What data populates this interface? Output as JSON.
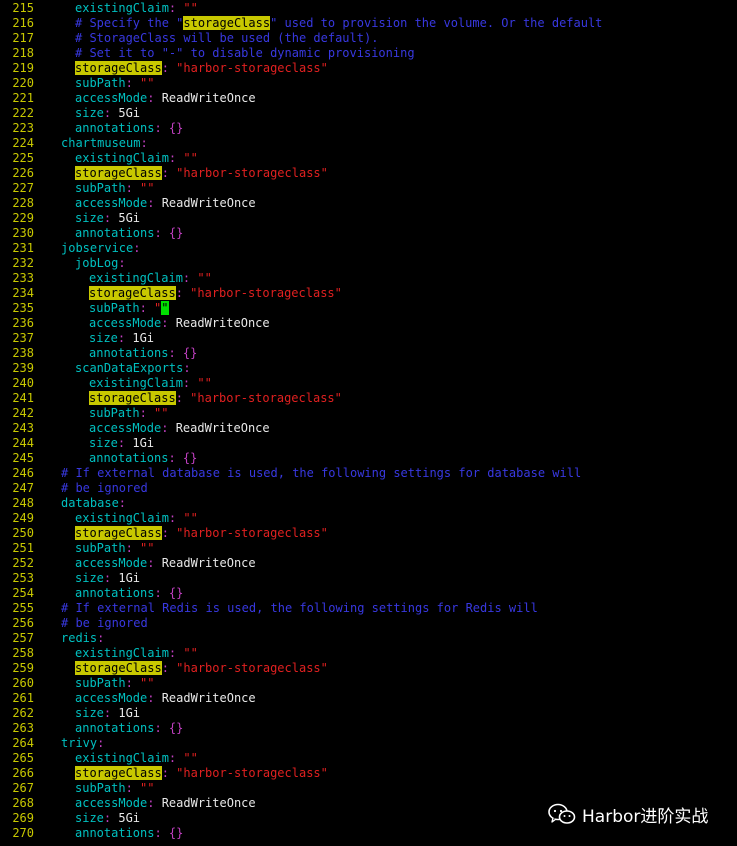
{
  "editor": {
    "colors": {
      "line_number": "#c8c800",
      "key": "#00c0c0",
      "punct": "#c040c0",
      "string": "#e02020",
      "value": "#e8e8e8",
      "comment": "#3838e0",
      "highlight": "#c8c800",
      "cursor": "#00e000"
    },
    "lines": [
      {
        "n": "215",
        "indent": 2,
        "segs": [
          [
            "k",
            "existingClaim"
          ],
          [
            "p",
            ": "
          ],
          [
            "s",
            "\"\""
          ]
        ]
      },
      {
        "n": "216",
        "indent": 2,
        "segs": [
          [
            "c",
            "# Specify the \""
          ],
          [
            "hl",
            "storageClass"
          ],
          [
            "c",
            "\" used to provision the volume. Or the default"
          ]
        ]
      },
      {
        "n": "217",
        "indent": 2,
        "segs": [
          [
            "c",
            "# StorageClass will be used (the default)."
          ]
        ]
      },
      {
        "n": "218",
        "indent": 2,
        "segs": [
          [
            "c",
            "# Set it to \"-\" to disable dynamic provisioning"
          ]
        ]
      },
      {
        "n": "219",
        "indent": 2,
        "segs": [
          [
            "hl",
            "storageClass"
          ],
          [
            "p",
            ": "
          ],
          [
            "s",
            "\"harbor-storageclass\""
          ]
        ]
      },
      {
        "n": "220",
        "indent": 2,
        "segs": [
          [
            "k",
            "subPath"
          ],
          [
            "p",
            ": "
          ],
          [
            "s",
            "\"\""
          ]
        ]
      },
      {
        "n": "221",
        "indent": 2,
        "segs": [
          [
            "k",
            "accessMode"
          ],
          [
            "p",
            ": "
          ],
          [
            "v",
            "ReadWriteOnce"
          ]
        ]
      },
      {
        "n": "222",
        "indent": 2,
        "segs": [
          [
            "k",
            "size"
          ],
          [
            "p",
            ": "
          ],
          [
            "v",
            "5Gi"
          ]
        ]
      },
      {
        "n": "223",
        "indent": 2,
        "segs": [
          [
            "k",
            "annotations"
          ],
          [
            "p",
            ": {}"
          ]
        ]
      },
      {
        "n": "224",
        "indent": 1,
        "segs": [
          [
            "k",
            "chartmuseum"
          ],
          [
            "p",
            ":"
          ]
        ]
      },
      {
        "n": "225",
        "indent": 2,
        "segs": [
          [
            "k",
            "existingClaim"
          ],
          [
            "p",
            ": "
          ],
          [
            "s",
            "\"\""
          ]
        ]
      },
      {
        "n": "226",
        "indent": 2,
        "segs": [
          [
            "hl",
            "storageClass"
          ],
          [
            "p",
            ": "
          ],
          [
            "s",
            "\"harbor-storageclass\""
          ]
        ]
      },
      {
        "n": "227",
        "indent": 2,
        "segs": [
          [
            "k",
            "subPath"
          ],
          [
            "p",
            ": "
          ],
          [
            "s",
            "\"\""
          ]
        ]
      },
      {
        "n": "228",
        "indent": 2,
        "segs": [
          [
            "k",
            "accessMode"
          ],
          [
            "p",
            ": "
          ],
          [
            "v",
            "ReadWriteOnce"
          ]
        ]
      },
      {
        "n": "229",
        "indent": 2,
        "segs": [
          [
            "k",
            "size"
          ],
          [
            "p",
            ": "
          ],
          [
            "v",
            "5Gi"
          ]
        ]
      },
      {
        "n": "230",
        "indent": 2,
        "segs": [
          [
            "k",
            "annotations"
          ],
          [
            "p",
            ": {}"
          ]
        ]
      },
      {
        "n": "231",
        "indent": 1,
        "segs": [
          [
            "k",
            "jobservice"
          ],
          [
            "p",
            ":"
          ]
        ]
      },
      {
        "n": "232",
        "indent": 2,
        "segs": [
          [
            "k",
            "jobLog"
          ],
          [
            "p",
            ":"
          ]
        ]
      },
      {
        "n": "233",
        "indent": 3,
        "segs": [
          [
            "k",
            "existingClaim"
          ],
          [
            "p",
            ": "
          ],
          [
            "s",
            "\"\""
          ]
        ]
      },
      {
        "n": "234",
        "indent": 3,
        "segs": [
          [
            "hl",
            "storageClass"
          ],
          [
            "p",
            ": "
          ],
          [
            "s",
            "\"harbor-storageclass\""
          ]
        ]
      },
      {
        "n": "235",
        "indent": 3,
        "segs": [
          [
            "k",
            "subPath"
          ],
          [
            "p",
            ": "
          ],
          [
            "s",
            "\""
          ],
          [
            "cur",
            "\""
          ]
        ]
      },
      {
        "n": "236",
        "indent": 3,
        "segs": [
          [
            "k",
            "accessMode"
          ],
          [
            "p",
            ": "
          ],
          [
            "v",
            "ReadWriteOnce"
          ]
        ]
      },
      {
        "n": "237",
        "indent": 3,
        "segs": [
          [
            "k",
            "size"
          ],
          [
            "p",
            ": "
          ],
          [
            "v",
            "1Gi"
          ]
        ]
      },
      {
        "n": "238",
        "indent": 3,
        "segs": [
          [
            "k",
            "annotations"
          ],
          [
            "p",
            ": {}"
          ]
        ]
      },
      {
        "n": "239",
        "indent": 2,
        "segs": [
          [
            "k",
            "scanDataExports"
          ],
          [
            "p",
            ":"
          ]
        ]
      },
      {
        "n": "240",
        "indent": 3,
        "segs": [
          [
            "k",
            "existingClaim"
          ],
          [
            "p",
            ": "
          ],
          [
            "s",
            "\"\""
          ]
        ]
      },
      {
        "n": "241",
        "indent": 3,
        "segs": [
          [
            "hl",
            "storageClass"
          ],
          [
            "p",
            ": "
          ],
          [
            "s",
            "\"harbor-storageclass\""
          ]
        ]
      },
      {
        "n": "242",
        "indent": 3,
        "segs": [
          [
            "k",
            "subPath"
          ],
          [
            "p",
            ": "
          ],
          [
            "s",
            "\"\""
          ]
        ]
      },
      {
        "n": "243",
        "indent": 3,
        "segs": [
          [
            "k",
            "accessMode"
          ],
          [
            "p",
            ": "
          ],
          [
            "v",
            "ReadWriteOnce"
          ]
        ]
      },
      {
        "n": "244",
        "indent": 3,
        "segs": [
          [
            "k",
            "size"
          ],
          [
            "p",
            ": "
          ],
          [
            "v",
            "1Gi"
          ]
        ]
      },
      {
        "n": "245",
        "indent": 3,
        "segs": [
          [
            "k",
            "annotations"
          ],
          [
            "p",
            ": {}"
          ]
        ]
      },
      {
        "n": "246",
        "indent": 1,
        "segs": [
          [
            "c",
            "# If external database is used, the following settings for database will"
          ]
        ]
      },
      {
        "n": "247",
        "indent": 1,
        "segs": [
          [
            "c",
            "# be ignored"
          ]
        ]
      },
      {
        "n": "248",
        "indent": 1,
        "segs": [
          [
            "k",
            "database"
          ],
          [
            "p",
            ":"
          ]
        ]
      },
      {
        "n": "249",
        "indent": 2,
        "segs": [
          [
            "k",
            "existingClaim"
          ],
          [
            "p",
            ": "
          ],
          [
            "s",
            "\"\""
          ]
        ]
      },
      {
        "n": "250",
        "indent": 2,
        "segs": [
          [
            "hl",
            "storageClass"
          ],
          [
            "p",
            ": "
          ],
          [
            "s",
            "\"harbor-storageclass\""
          ]
        ]
      },
      {
        "n": "251",
        "indent": 2,
        "segs": [
          [
            "k",
            "subPath"
          ],
          [
            "p",
            ": "
          ],
          [
            "s",
            "\"\""
          ]
        ]
      },
      {
        "n": "252",
        "indent": 2,
        "segs": [
          [
            "k",
            "accessMode"
          ],
          [
            "p",
            ": "
          ],
          [
            "v",
            "ReadWriteOnce"
          ]
        ]
      },
      {
        "n": "253",
        "indent": 2,
        "segs": [
          [
            "k",
            "size"
          ],
          [
            "p",
            ": "
          ],
          [
            "v",
            "1Gi"
          ]
        ]
      },
      {
        "n": "254",
        "indent": 2,
        "segs": [
          [
            "k",
            "annotations"
          ],
          [
            "p",
            ": {}"
          ]
        ]
      },
      {
        "n": "255",
        "indent": 1,
        "segs": [
          [
            "c",
            "# If external Redis is used, the following settings for Redis will"
          ]
        ]
      },
      {
        "n": "256",
        "indent": 1,
        "segs": [
          [
            "c",
            "# be ignored"
          ]
        ]
      },
      {
        "n": "257",
        "indent": 1,
        "segs": [
          [
            "k",
            "redis"
          ],
          [
            "p",
            ":"
          ]
        ]
      },
      {
        "n": "258",
        "indent": 2,
        "segs": [
          [
            "k",
            "existingClaim"
          ],
          [
            "p",
            ": "
          ],
          [
            "s",
            "\"\""
          ]
        ]
      },
      {
        "n": "259",
        "indent": 2,
        "segs": [
          [
            "hl",
            "storageClass"
          ],
          [
            "p",
            ": "
          ],
          [
            "s",
            "\"harbor-storageclass\""
          ]
        ]
      },
      {
        "n": "260",
        "indent": 2,
        "segs": [
          [
            "k",
            "subPath"
          ],
          [
            "p",
            ": "
          ],
          [
            "s",
            "\"\""
          ]
        ]
      },
      {
        "n": "261",
        "indent": 2,
        "segs": [
          [
            "k",
            "accessMode"
          ],
          [
            "p",
            ": "
          ],
          [
            "v",
            "ReadWriteOnce"
          ]
        ]
      },
      {
        "n": "262",
        "indent": 2,
        "segs": [
          [
            "k",
            "size"
          ],
          [
            "p",
            ": "
          ],
          [
            "v",
            "1Gi"
          ]
        ]
      },
      {
        "n": "263",
        "indent": 2,
        "segs": [
          [
            "k",
            "annotations"
          ],
          [
            "p",
            ": {}"
          ]
        ]
      },
      {
        "n": "264",
        "indent": 1,
        "segs": [
          [
            "k",
            "trivy"
          ],
          [
            "p",
            ":"
          ]
        ]
      },
      {
        "n": "265",
        "indent": 2,
        "segs": [
          [
            "k",
            "existingClaim"
          ],
          [
            "p",
            ": "
          ],
          [
            "s",
            "\"\""
          ]
        ]
      },
      {
        "n": "266",
        "indent": 2,
        "segs": [
          [
            "hl",
            "storageClass"
          ],
          [
            "p",
            ": "
          ],
          [
            "s",
            "\"harbor-storageclass\""
          ]
        ]
      },
      {
        "n": "267",
        "indent": 2,
        "segs": [
          [
            "k",
            "subPath"
          ],
          [
            "p",
            ": "
          ],
          [
            "s",
            "\"\""
          ]
        ]
      },
      {
        "n": "268",
        "indent": 2,
        "segs": [
          [
            "k",
            "accessMode"
          ],
          [
            "p",
            ": "
          ],
          [
            "v",
            "ReadWriteOnce"
          ]
        ]
      },
      {
        "n": "269",
        "indent": 2,
        "segs": [
          [
            "k",
            "size"
          ],
          [
            "p",
            ": "
          ],
          [
            "v",
            "5Gi"
          ]
        ]
      },
      {
        "n": "270",
        "indent": 2,
        "segs": [
          [
            "k",
            "annotations"
          ],
          [
            "p",
            ": {}"
          ]
        ]
      }
    ]
  },
  "watermark": {
    "icon": "wechat-icon",
    "text": "Harbor进阶实战"
  }
}
